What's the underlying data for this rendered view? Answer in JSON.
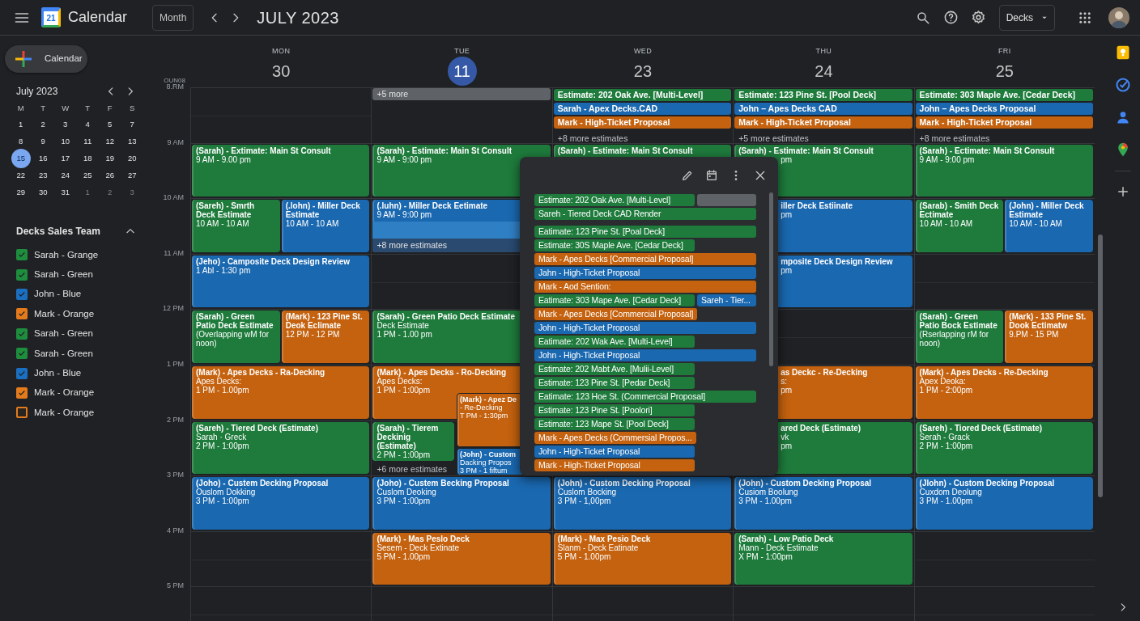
{
  "topbar": {
    "logo_text": "21",
    "app_name": "Calendar",
    "view_button": "Month",
    "title": "JULY 2023",
    "account_menu": "Decks"
  },
  "create_button": "Calendar",
  "mini_calendar": {
    "title": "July 2023",
    "weekdays": [
      "M",
      "T",
      "W",
      "T",
      "F",
      "S"
    ],
    "weeks": [
      [
        {
          "text": "1",
          "other_month": false,
          "selected": false
        },
        {
          "text": "2",
          "other_month": false,
          "selected": false
        },
        {
          "text": "3",
          "other_month": false,
          "selected": false
        },
        {
          "text": "4",
          "other_month": false,
          "selected": false
        },
        {
          "text": "5",
          "other_month": false,
          "selected": false
        },
        {
          "text": "7",
          "other_month": false,
          "selected": false
        }
      ],
      [
        {
          "text": "8",
          "other_month": false,
          "selected": false
        },
        {
          "text": "9",
          "other_month": false,
          "selected": false
        },
        {
          "text": "10",
          "other_month": false,
          "selected": false
        },
        {
          "text": "11",
          "other_month": false,
          "selected": false
        },
        {
          "text": "12",
          "other_month": false,
          "selected": false
        },
        {
          "text": "13",
          "other_month": false,
          "selected": false
        }
      ],
      [
        {
          "text": "15",
          "other_month": false,
          "selected": true
        },
        {
          "text": "16",
          "other_month": false,
          "selected": false
        },
        {
          "text": "17",
          "other_month": false,
          "selected": false
        },
        {
          "text": "18",
          "other_month": false,
          "selected": false
        },
        {
          "text": "19",
          "other_month": false,
          "selected": false
        },
        {
          "text": "20",
          "other_month": false,
          "selected": false
        }
      ],
      [
        {
          "text": "22",
          "other_month": false,
          "selected": false
        },
        {
          "text": "23",
          "other_month": false,
          "selected": false
        },
        {
          "text": "24",
          "other_month": false,
          "selected": false
        },
        {
          "text": "25",
          "other_month": false,
          "selected": false
        },
        {
          "text": "26",
          "other_month": false,
          "selected": false
        },
        {
          "text": "27",
          "other_month": false,
          "selected": false
        }
      ],
      [
        {
          "text": "29",
          "other_month": false,
          "selected": false
        },
        {
          "text": "30",
          "other_month": false,
          "selected": false
        },
        {
          "text": "31",
          "other_month": false,
          "selected": false
        },
        {
          "text": "1",
          "other_month": true,
          "selected": false
        },
        {
          "text": "2",
          "other_month": true,
          "selected": false
        },
        {
          "text": "3",
          "other_month": true,
          "selected": false
        }
      ]
    ]
  },
  "calendar_group": {
    "title": "Decks Sales Team",
    "expanded": true,
    "items": [
      {
        "label": "Sarah - Grange",
        "color": "#1e8e3e",
        "checked": true
      },
      {
        "label": "Sarah - Green",
        "color": "#1e8e3e",
        "checked": true
      },
      {
        "label": "John - Blue",
        "color": "#1a6fc0",
        "checked": true
      },
      {
        "label": "Mark - Orange",
        "color": "#e37b1c",
        "checked": true
      },
      {
        "label": "Sarah - Green",
        "color": "#1e8e3e",
        "checked": true
      },
      {
        "label": "Sarah - Green",
        "color": "#1e8e3e",
        "checked": true
      },
      {
        "label": "John - Blue",
        "color": "#1a6fc0",
        "checked": true
      },
      {
        "label": "Mark - Orange",
        "color": "#e37b1c",
        "checked": true
      },
      {
        "label": "Mark - Orange",
        "color": "#e37b1c",
        "checked": false
      }
    ]
  },
  "hours": [
    {
      "label": "8.RM",
      "sublabel": "OUN08"
    },
    {
      "label": "9 AM"
    },
    {
      "label": "10 AM"
    },
    {
      "label": "11 AM"
    },
    {
      "label": "12 PM"
    },
    {
      "label": "1 PM"
    },
    {
      "label": "2 PM"
    },
    {
      "label": "3 PM"
    },
    {
      "label": "4 PM"
    },
    {
      "label": "5 PM"
    }
  ],
  "days": [
    {
      "weekday": "MON",
      "date": "30",
      "today": false,
      "slots": [
        {
          "kind": "free"
        },
        {
          "events": [
            {
              "kind": "event",
              "color": "#1e7b3c",
              "title": "(Sarah) - Extimate: Main St Consult",
              "lines": [
                "9 AM - 9.00 pm"
              ]
            }
          ]
        },
        {
          "events": [
            {
              "kind": "event",
              "color": "#1e7b3c",
              "title": "(Sareh) - Smrth Deck Estimate",
              "lines": [
                "10 AM - 10 AM"
              ]
            },
            {
              "kind": "event",
              "color": "#1a68b0",
              "title": "(.lohn) - Miller Deck Estimate",
              "lines": [
                "10 AM - 10 AM"
              ]
            }
          ]
        },
        {
          "events": [
            {
              "kind": "event",
              "color": "#1a68b0",
              "title": "(Jeho) - Camposite Deck Design Review",
              "lines": [
                "1 Abl - 1:30 pm"
              ]
            }
          ]
        },
        {
          "events": [
            {
              "kind": "event",
              "color": "#1e7b3c",
              "title": "(Sarah) - Green Patio Deck Estimate",
              "lines": [
                "(Overlapping wM for noon)"
              ]
            },
            {
              "kind": "event",
              "color": "#c4620f",
              "title": "(Mark) - 123 Pine St. Deok Eclimate",
              "lines": [
                "12 PM - 12 PM"
              ]
            }
          ]
        },
        {
          "events": [
            {
              "kind": "event",
              "color": "#c4620f",
              "title": "(Mark) - Apes Decks - Ra-Decking",
              "lines": [
                "Apes Decks:",
                "1 PM - 1.00pm"
              ]
            }
          ]
        },
        {
          "events": [
            {
              "kind": "event",
              "color": "#1e7b3c",
              "title": "(Sareh) - Tiered Deck (Estimate)",
              "lines": [
                "Sarah · Greck",
                "2 PM - 1:00pm"
              ]
            }
          ]
        },
        {
          "events": [
            {
              "kind": "event",
              "color": "#1a68b0",
              "title": "(Joho) - Custem Decking Proposal",
              "lines": [
                "Ouslom Dokking",
                "3 PM - 1:00pm"
              ]
            }
          ]
        },
        {
          "kind": "free"
        }
      ]
    },
    {
      "weekday": "TUE",
      "date": "11",
      "today": true,
      "slots": [
        {
          "events": [
            {
              "kind": "more_bar",
              "text": "+5 more"
            }
          ]
        },
        {
          "events": [
            {
              "kind": "event",
              "color": "#1e7b3c",
              "title": "(Sarah) - Estimate: Main St Consult",
              "lines": [
                "9 AM - 9:00 pm"
              ]
            }
          ]
        },
        {
          "events": [
            {
              "kind": "event",
              "color": "#1a68b0",
              "title": "(.luhn) - Miller Deck Eetimate",
              "lines": [
                "9 AM - 9:00 pm"
              ],
              "footer": "+8 more estimates"
            }
          ]
        },
        {
          "kind": "free"
        },
        {
          "events": [
            {
              "kind": "event",
              "color": "#1e7b3c",
              "title": "(Sarah) - Green Patio Deck Estimate",
              "lines": [
                "Deck Estimate",
                "1 PM - 1.00 pm"
              ]
            }
          ]
        },
        {
          "events": [
            {
              "kind": "event",
              "color": "#c4620f",
              "title": "(Mark) - Apes Decks - Ro-Decking",
              "lines": [
                "Apes Decks:",
                "1 PM - 1:00pm"
              ]
            },
            {
              "kind": "overlap",
              "color": "#c4620f",
              "title": "(Mark) - Apez De",
              "lines": [
                "- Re-Decking",
                "T PM - 1:30pm"
              ]
            }
          ]
        },
        {
          "events": [
            {
              "kind": "short",
              "color": "#1e7b3c",
              "title": "(Sarah) - Tierem Deckinig (Estimate)",
              "lines": [
                "2 PM - 1:00pm"
              ]
            },
            {
              "kind": "overlap_short",
              "color": "#1a68b0",
              "title": "(John) - Custom",
              "lines": [
                "Dacking Propos",
                "3 PM - 1 fiftum"
              ]
            }
          ],
          "more": "+6 more estimates"
        },
        {
          "events": [
            {
              "kind": "event",
              "color": "#1a68b0",
              "title": "(Joho) - Custem Becking Proposal",
              "lines": [
                "Cuslom Deoking",
                "3 PM - 1:00pm"
              ]
            }
          ]
        },
        {
          "events": [
            {
              "kind": "event",
              "color": "#c4620f",
              "title": "(Mark) - Mas Peslo Deck",
              "lines": [
                "Sesem - Deck Extinate",
                "5 PM - 1.00pm"
              ]
            }
          ]
        }
      ]
    },
    {
      "weekday": "WED",
      "date": "23",
      "today": false,
      "slots": [
        {
          "events": [
            {
              "kind": "chip",
              "color": "#1e7b3c",
              "title": "Estimate: 202 Oak Ave. [Multi-Level]"
            },
            {
              "kind": "chip",
              "color": "#1a68b0",
              "title": "Sarah - Apex Decks.CAD"
            },
            {
              "kind": "chip",
              "color": "#c4620f",
              "title": "Mark - High-Ticket Proposal"
            }
          ],
          "more": "+8 more estimates"
        },
        {
          "events": [
            {
              "kind": "event",
              "color": "#1e7b3c",
              "title": "(Sarah) - Estimate: Main St Consult"
            }
          ]
        },
        {
          "kind": "free"
        },
        {
          "kind": "free"
        },
        {
          "kind": "free"
        },
        {
          "kind": "free"
        },
        {
          "kind": "free"
        },
        {
          "events": [
            {
              "kind": "event",
              "color": "#1a68b0",
              "title": "(John) - Custom Decking Proposal",
              "lines": [
                "Cuslom Bocking",
                "3 PM - 1,00pm"
              ]
            }
          ]
        },
        {
          "events": [
            {
              "kind": "event",
              "color": "#c4620f",
              "title": "(Mark) - Max Pesio Deck",
              "lines": [
                "Slanm - Deck Eatinate",
                "5 PM - 1.00pm"
              ]
            }
          ]
        }
      ]
    },
    {
      "weekday": "THU",
      "date": "24",
      "today": false,
      "slots": [
        {
          "events": [
            {
              "kind": "chip",
              "color": "#1e7b3c",
              "title": "Estimate: 123 Pine St. [Pool Deck]"
            },
            {
              "kind": "chip",
              "color": "#1a68b0",
              "title": "John – Apes Decks CAD"
            },
            {
              "kind": "chip",
              "color": "#c4620f",
              "title": "Mark - High-Ticket Proposal"
            }
          ],
          "more": "+5 more estimates"
        },
        {
          "events": [
            {
              "kind": "event",
              "color": "#1e7b3c",
              "title": "(Sarah) - Estimate: Main St Consult",
              "lines": [
                "pm"
              ],
              "title_cut": false,
              "lines_cut": true
            }
          ]
        },
        {
          "events": [
            {
              "kind": "event",
              "color": "#1a68b0",
              "title": "iller Deck Estiinate",
              "lines": [
                "pm"
              ],
              "title_cut": true,
              "lines_cut": true
            }
          ]
        },
        {
          "events": [
            {
              "kind": "event",
              "color": "#1a68b0",
              "title": "mposite Deck Design Review",
              "lines": [
                "pm"
              ],
              "title_cut": true,
              "lines_cut": true
            }
          ]
        },
        {
          "kind": "free"
        },
        {
          "events": [
            {
              "kind": "event",
              "color": "#c4620f",
              "title": "as Deckc - Re-Decking",
              "lines": [
                "s:",
                "pm"
              ],
              "title_cut": true,
              "lines_cut": true
            }
          ]
        },
        {
          "events": [
            {
              "kind": "event",
              "color": "#1e7b3c",
              "title": "ared Deck (Estimate)",
              "lines": [
                "vk",
                "pm"
              ],
              "title_cut": true,
              "lines_cut": true
            }
          ]
        },
        {
          "events": [
            {
              "kind": "event",
              "color": "#1a68b0",
              "title": "(John) - Custom Decking Proposal",
              "lines": [
                "Cusiom Boolung",
                "3 PM - 1.00pm"
              ]
            }
          ]
        },
        {
          "events": [
            {
              "kind": "event",
              "color": "#1e7b3c",
              "title": "(Sarah) - Low Patio Deck",
              "lines": [
                "Mann - Deck Estimate",
                "X PM - 1:00pm"
              ]
            }
          ]
        }
      ]
    },
    {
      "weekday": "FRI",
      "date": "25",
      "today": false,
      "slots": [
        {
          "events": [
            {
              "kind": "chip",
              "color": "#1e7b3c",
              "title": "Estimate: 303 Maple Ave. [Cedar Deck]"
            },
            {
              "kind": "chip",
              "color": "#1a68b0",
              "title": "John – Apes Decks Proposal"
            },
            {
              "kind": "chip",
              "color": "#c4620f",
              "title": "Mark - High-Ticket Proposal"
            }
          ],
          "more": "+8 more estimates"
        },
        {
          "events": [
            {
              "kind": "event",
              "color": "#1e7b3c",
              "title": "(Sarah) - Ectimate: Main St Consult",
              "lines": [
                "9 AM - 9:00 pm"
              ]
            }
          ]
        },
        {
          "events": [
            {
              "kind": "event",
              "color": "#1e7b3c",
              "title": "(Sarab) - Smith Deck Ectimate",
              "lines": [
                "10 AM - 10 AM"
              ]
            },
            {
              "kind": "event",
              "color": "#1a68b0",
              "title": "(John) - Miller Deck Estimate",
              "lines": [
                "10 AM - 10 AM"
              ]
            }
          ]
        },
        {
          "kind": "free"
        },
        {
          "events": [
            {
              "kind": "event",
              "color": "#1e7b3c",
              "title": "(Sarah) - Green Patio Bock Estimate",
              "lines": [
                "(Rserlapping rM for noon)"
              ]
            },
            {
              "kind": "event",
              "color": "#c4620f",
              "title": "(Mark) - 133 Pine St. Dook Ectimatw",
              "lines": [
                "9.PM - 15 PM"
              ]
            }
          ]
        },
        {
          "events": [
            {
              "kind": "event",
              "color": "#c4620f",
              "title": "(Mark) - Apes Decks - Re-Decking",
              "lines": [
                "Apex Deoka:",
                "1 PM - 2:00pm"
              ]
            }
          ]
        },
        {
          "events": [
            {
              "kind": "event",
              "color": "#1e7b3c",
              "title": "(Sareh) - Tiored Deck (Estimate)",
              "lines": [
                "Serah - Grack",
                "2 PM - 1:00pm"
              ]
            }
          ]
        },
        {
          "events": [
            {
              "kind": "event",
              "color": "#1a68b0",
              "title": "(Jlohn) - Custom Decking Proposal",
              "lines": [
                "Cuxdom Deolung",
                "3 PM - 1.00pm"
              ]
            }
          ]
        },
        {
          "kind": "free"
        }
      ]
    }
  ],
  "popup": {
    "sections": [
      [
        [
          {
            "text": "Estimate: 202 Oak Ave. [Multi-Levcl]",
            "color": "#1e7b3c",
            "wide": false
          },
          {
            "color": "#5f6368"
          }
        ],
        [
          {
            "text": "Sareh - Tiered Deck CAD Render",
            "color": "#1e7b3c",
            "wide": true
          }
        ]
      ],
      [
        [
          {
            "text": "Eatimate: 123 Pine St. [Poal Deck]",
            "color": "#1e7b3c",
            "wide": true
          }
        ],
        [
          {
            "text": "Estimate: 30S Maple Ave. [Cedar Deck]",
            "color": "#1e7b3c",
            "wide": false
          }
        ],
        [
          {
            "text": "Mark - Apes Decks [Commercial Proposal]",
            "color": "#c4620f",
            "wide": true
          }
        ],
        [
          {
            "text": "Jahn - High-Ticket Proposal",
            "color": "#1a68b0",
            "wide": true
          }
        ],
        [
          {
            "text": "Mark - Aod Sention:",
            "color": "#c4620f",
            "wide": true
          }
        ],
        [
          {
            "text": "Eatimate: 303 Mape Ave. [Cedar Deck]",
            "color": "#1e7b3c",
            "wide": false
          },
          {
            "text": "Sareh - Tier...",
            "color": "#1a68b0"
          }
        ],
        [
          {
            "text": "Mark - Apes Decks [Commercial Proposal]",
            "color": "#c4620f",
            "wide": false
          }
        ],
        [
          {
            "text": "John - High-Ticket Proposal",
            "color": "#1a68b0",
            "wide": true
          }
        ],
        [
          {
            "text": "Eatimate: 202 Wak Ave. [Multi-Level]",
            "color": "#1e7b3c",
            "wide": false
          }
        ],
        [
          {
            "text": "John - High-Ticket Proposal",
            "color": "#1a68b0",
            "wide": true
          }
        ],
        [
          {
            "text": "Estimate: 202 Mabt Ave. [Mulii-Level]",
            "color": "#1e7b3c",
            "wide": false
          }
        ],
        [
          {
            "text": "Estimate: 123 Pine St. [Pedar Deck]",
            "color": "#1e7b3c",
            "wide": false
          }
        ],
        [
          {
            "text": "Eatimate: 123 Hoe St. (Commercial Proposal]",
            "color": "#1e7b3c",
            "wide": true
          }
        ],
        [
          {
            "text": "Estimate: 123 Pine St. [Poolori]",
            "color": "#1e7b3c",
            "wide": false
          }
        ],
        [
          {
            "text": "Estimate: 123 Mape St. [Pool Deck]",
            "color": "#1e7b3c",
            "wide": false
          }
        ],
        [
          {
            "text": "Mark - Apes Decks (Commersial Propos...",
            "color": "#c4620f",
            "wide": false
          }
        ],
        [
          {
            "text": "John - High-Ticket Proposal",
            "color": "#1a68b0",
            "wide": false
          }
        ],
        [
          {
            "text": "Mark - High-Ticket Proposal",
            "color": "#c4620f",
            "wide": false
          }
        ]
      ]
    ]
  }
}
